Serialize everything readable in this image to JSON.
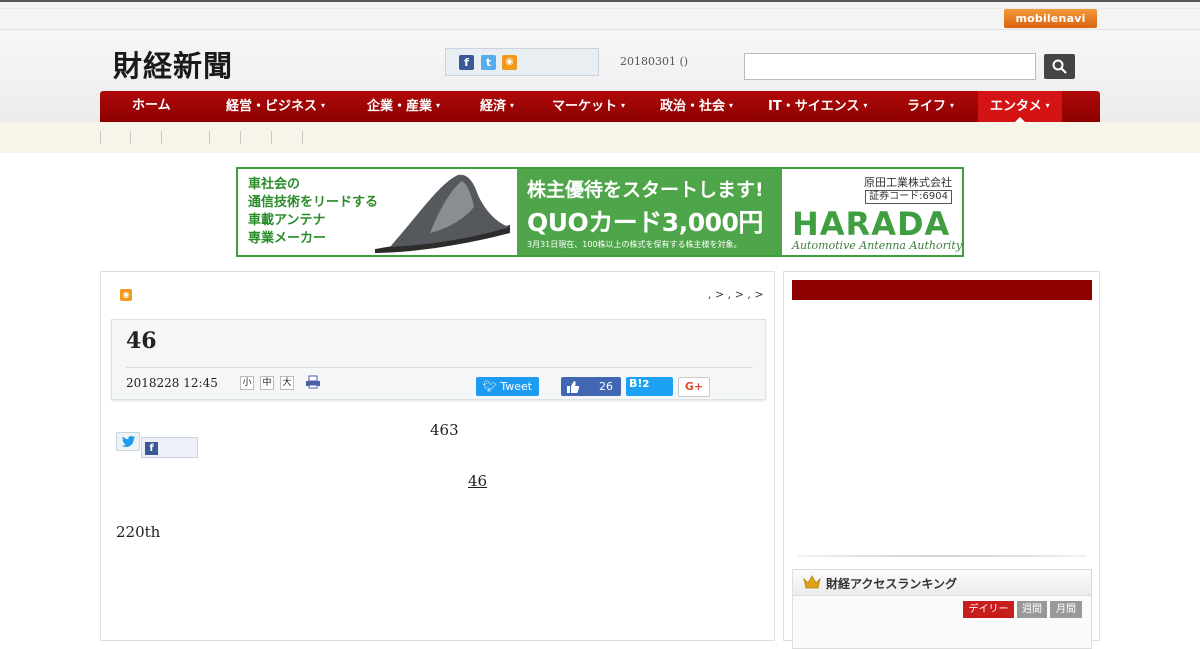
{
  "topbar": {
    "mobile_link": "mobilenavi"
  },
  "header": {
    "logo": "財経新聞",
    "date": "20180301 ()",
    "search": {
      "value": "",
      "button": "search"
    }
  },
  "nav": {
    "items": [
      {
        "label": "ホーム",
        "has_menu": false
      },
      {
        "label": "経営・ビジネス",
        "has_menu": true
      },
      {
        "label": "企業・産業",
        "has_menu": true
      },
      {
        "label": "経済",
        "has_menu": true
      },
      {
        "label": "マーケット",
        "has_menu": true
      },
      {
        "label": "政治・社会",
        "has_menu": true
      },
      {
        "label": "IT・サイエンス",
        "has_menu": true
      },
      {
        "label": "ライフ",
        "has_menu": true
      },
      {
        "label": "エンタメ",
        "has_menu": true,
        "active": true
      }
    ],
    "caret": "▾"
  },
  "banner": {
    "left_lines": [
      "車社会の",
      "通信技術をリードする",
      "車載アンテナ",
      "専業メーカー"
    ],
    "mid_line1": "株主優待をスタートします!",
    "mid_line2": "QUOカード3,000円",
    "mid_line3": "3月31日現在、100株以上の株式を保有する株主様を対象。",
    "company": "原田工業株式会社",
    "code": "証券コード:6904",
    "brand": "HARADA",
    "tagline": "Automotive Antenna Authority"
  },
  "article": {
    "breadcrumb": ", > , > , >",
    "title": "46",
    "pubdate": "2018228 12:45",
    "font_sizes": [
      "小",
      "中",
      "大"
    ],
    "tweet_label": "Tweet",
    "like_count": "26",
    "hatena_label": "B!",
    "hatena_count": "2",
    "gplus_label": "G+",
    "paragraphs": [
      "463",
      "46",
      "220th"
    ]
  },
  "sidebar": {
    "ranking_title": "財経アクセスランキング",
    "tabs": [
      "デイリー",
      "週間",
      "月間"
    ]
  },
  "colors": {
    "nav_red": "#8c0000",
    "nav_active": "#d41414",
    "banner_green": "#4fa64a",
    "twitter": "#1d9bf0",
    "facebook": "#4267b2"
  }
}
